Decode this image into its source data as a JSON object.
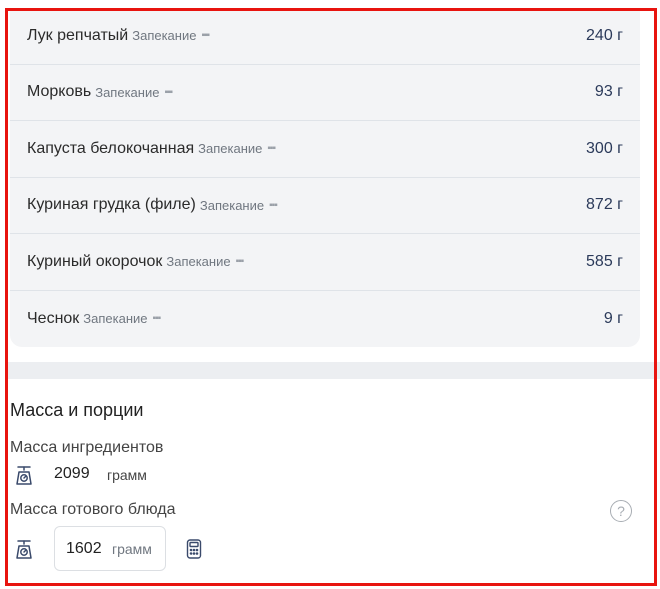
{
  "ingredients": [
    {
      "name": "Лук репчатый",
      "method": "Запекание",
      "amount": "240 г"
    },
    {
      "name": "Морковь",
      "method": "Запекание",
      "amount": "93 г"
    },
    {
      "name": "Капуста белокочанная",
      "method": "Запекание",
      "amount": "300 г"
    },
    {
      "name": "Куриная грудка (филе)",
      "method": "Запекание",
      "amount": "872 г"
    },
    {
      "name": "Куриный окорочок",
      "method": "Запекание",
      "amount": "585 г"
    },
    {
      "name": "Чеснок",
      "method": "Запекание",
      "amount": "9 г"
    }
  ],
  "mass": {
    "title": "Масса и порции",
    "ingredients_label": "Масса ингредиентов",
    "ingredients_value": "2099",
    "ingredients_unit": "грамм",
    "dish_label": "Масса готового блюда",
    "dish_value": "1602",
    "dish_unit": "грамм",
    "help_symbol": "?"
  },
  "icons": {
    "scale": "scale-icon",
    "help": "help-icon",
    "calculator": "calculator-icon",
    "more": "more-dots-icon"
  },
  "colors": {
    "frame": "#e8140f",
    "amount_text": "#2b3a5a",
    "panel_bg": "#f3f4f6"
  }
}
